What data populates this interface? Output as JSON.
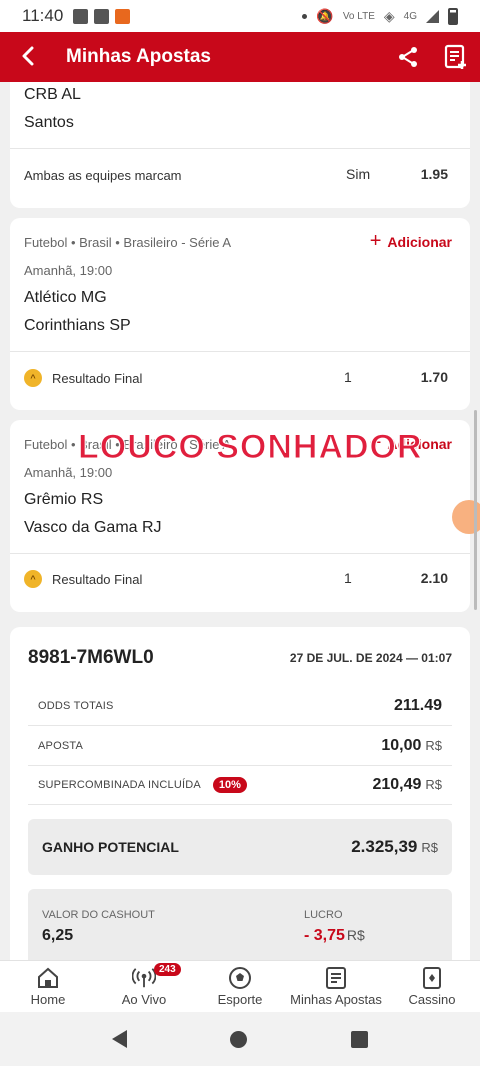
{
  "status_bar": {
    "time": "11:40",
    "network": "Vo LTE",
    "signal": "4G"
  },
  "app_bar": {
    "title": "Minhas Apostas"
  },
  "bets": [
    {
      "team_home": "CRB AL",
      "team_away": "Santos",
      "market": "Ambas as equipes marcam",
      "selection": "Sim",
      "odds": "1.95"
    },
    {
      "meta": "Futebol • Brasil • Brasileiro - Série A",
      "add_label": "Adicionar",
      "time": "Amanhã, 19:00",
      "team_home": "Atlético MG",
      "team_away": "Corinthians SP",
      "market": "Resultado Final",
      "selection": "1",
      "odds": "1.70"
    },
    {
      "meta": "Futebol • Brasil • Brasileiro - Série A",
      "add_label": "Adicionar",
      "time": "Amanhã, 19:00",
      "team_home": "Grêmio RS",
      "team_away": "Vasco da Gama RJ",
      "market": "Resultado Final",
      "selection": "1",
      "odds": "2.10"
    }
  ],
  "watermark": "LOUCO SONHADOR",
  "summary": {
    "code": "8981-7M6WL0",
    "date": "27 DE JUL. DE 2024 — 01:07",
    "total_odds_label": "ODDS TOTAIS",
    "total_odds": "211.49",
    "stake_label": "APOSTA",
    "stake": "10,00",
    "currency": "R$",
    "boost_label": "SUPERCOMBINADA INCLUÍDA",
    "boost_badge": "10%",
    "boost_value": "210,49",
    "potential_label": "GANHO POTENCIAL",
    "potential_value": "2.325,39",
    "cashout_label": "VALOR DO CASHOUT",
    "cashout_value": "6,25",
    "profit_label": "LUCRO",
    "profit_value": "- 3,75"
  },
  "bottom_nav": [
    {
      "label": "Home",
      "icon": "home-icon"
    },
    {
      "label": "Ao Vivo",
      "icon": "live-icon",
      "badge": "243"
    },
    {
      "label": "Esporte",
      "icon": "soccer-ball-icon"
    },
    {
      "label": "Minhas Apostas",
      "icon": "bet-slip-icon"
    },
    {
      "label": "Cassino",
      "icon": "cards-icon"
    }
  ],
  "colors": {
    "brand": "#c8081a",
    "background": "#f0f0f0",
    "watermark": "#e01f3d"
  }
}
